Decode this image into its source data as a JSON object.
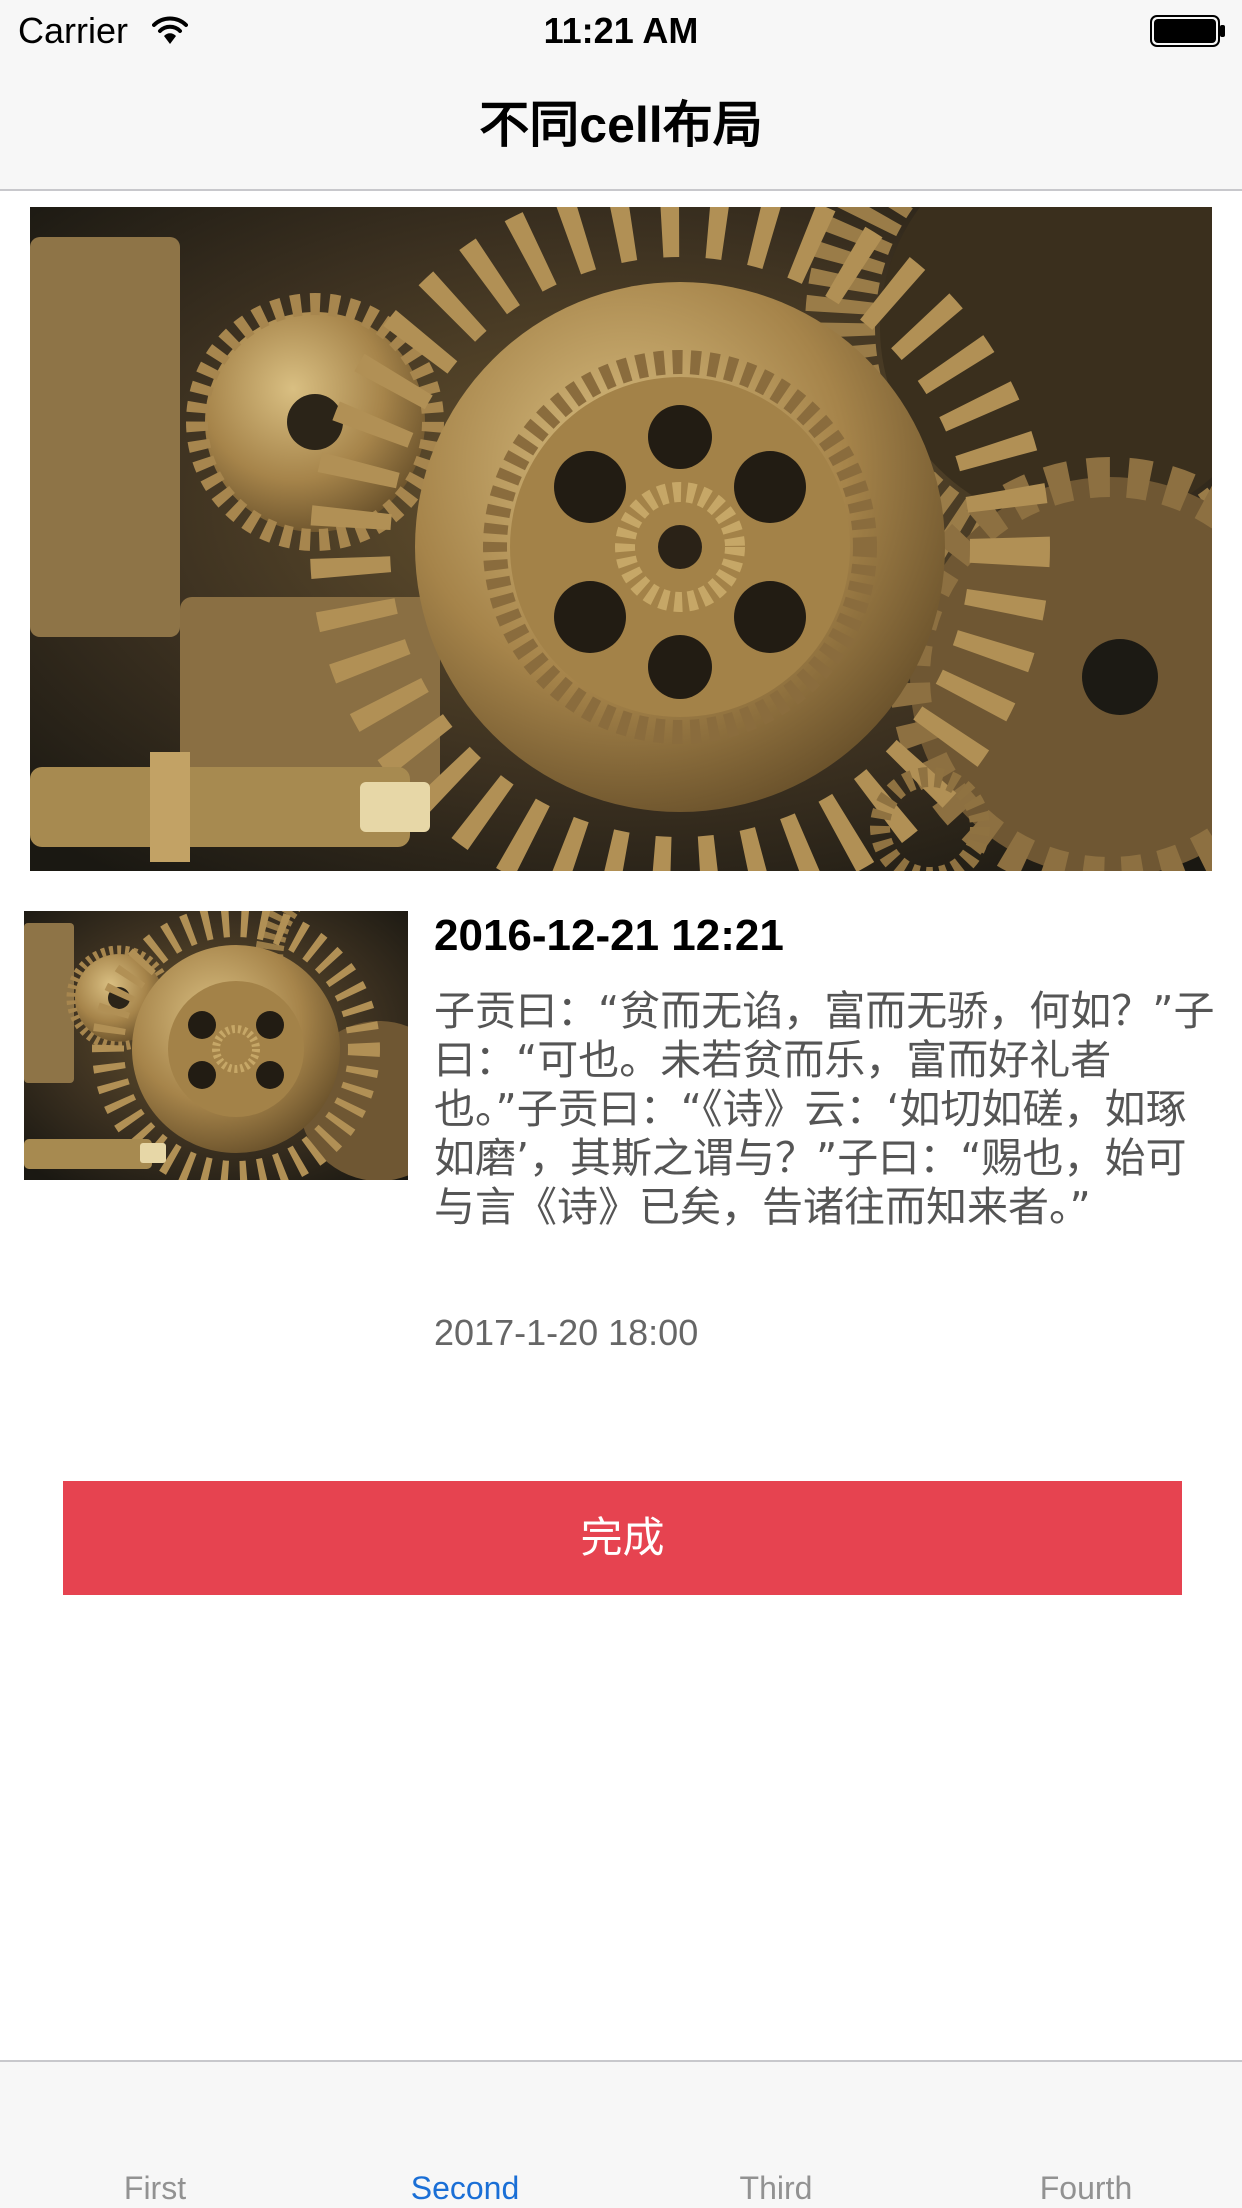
{
  "status_bar": {
    "carrier": "Carrier",
    "time": "11:21 AM",
    "wifi_icon": "wifi-icon",
    "battery_icon": "battery-icon"
  },
  "nav": {
    "title": "不同cell布局"
  },
  "hero": {
    "image": "gears-photo"
  },
  "cell": {
    "thumbnail": "gears-photo",
    "date": "2016-12-21 12:21",
    "body": "子贡曰：“贫而无谄，富而无骄，何如？”子曰：“可也。未若贫而乐，富而好礼者也。”子贡曰：“《诗》云：‘如切如磋，如琢如磨’，其斯之谓与？”子曰：“赐也，始可与言《诗》已矣，告诸往而知来者。”",
    "time": "2017-1-20 18:00"
  },
  "done_button": {
    "label": "完成",
    "color": "#e64350"
  },
  "tab_bar": {
    "active_color": "#1a6fd6",
    "inactive_color": "#929292",
    "items": [
      {
        "label": "First",
        "active": false
      },
      {
        "label": "Second",
        "active": true
      },
      {
        "label": "Third",
        "active": false
      },
      {
        "label": "Fourth",
        "active": false
      }
    ]
  }
}
